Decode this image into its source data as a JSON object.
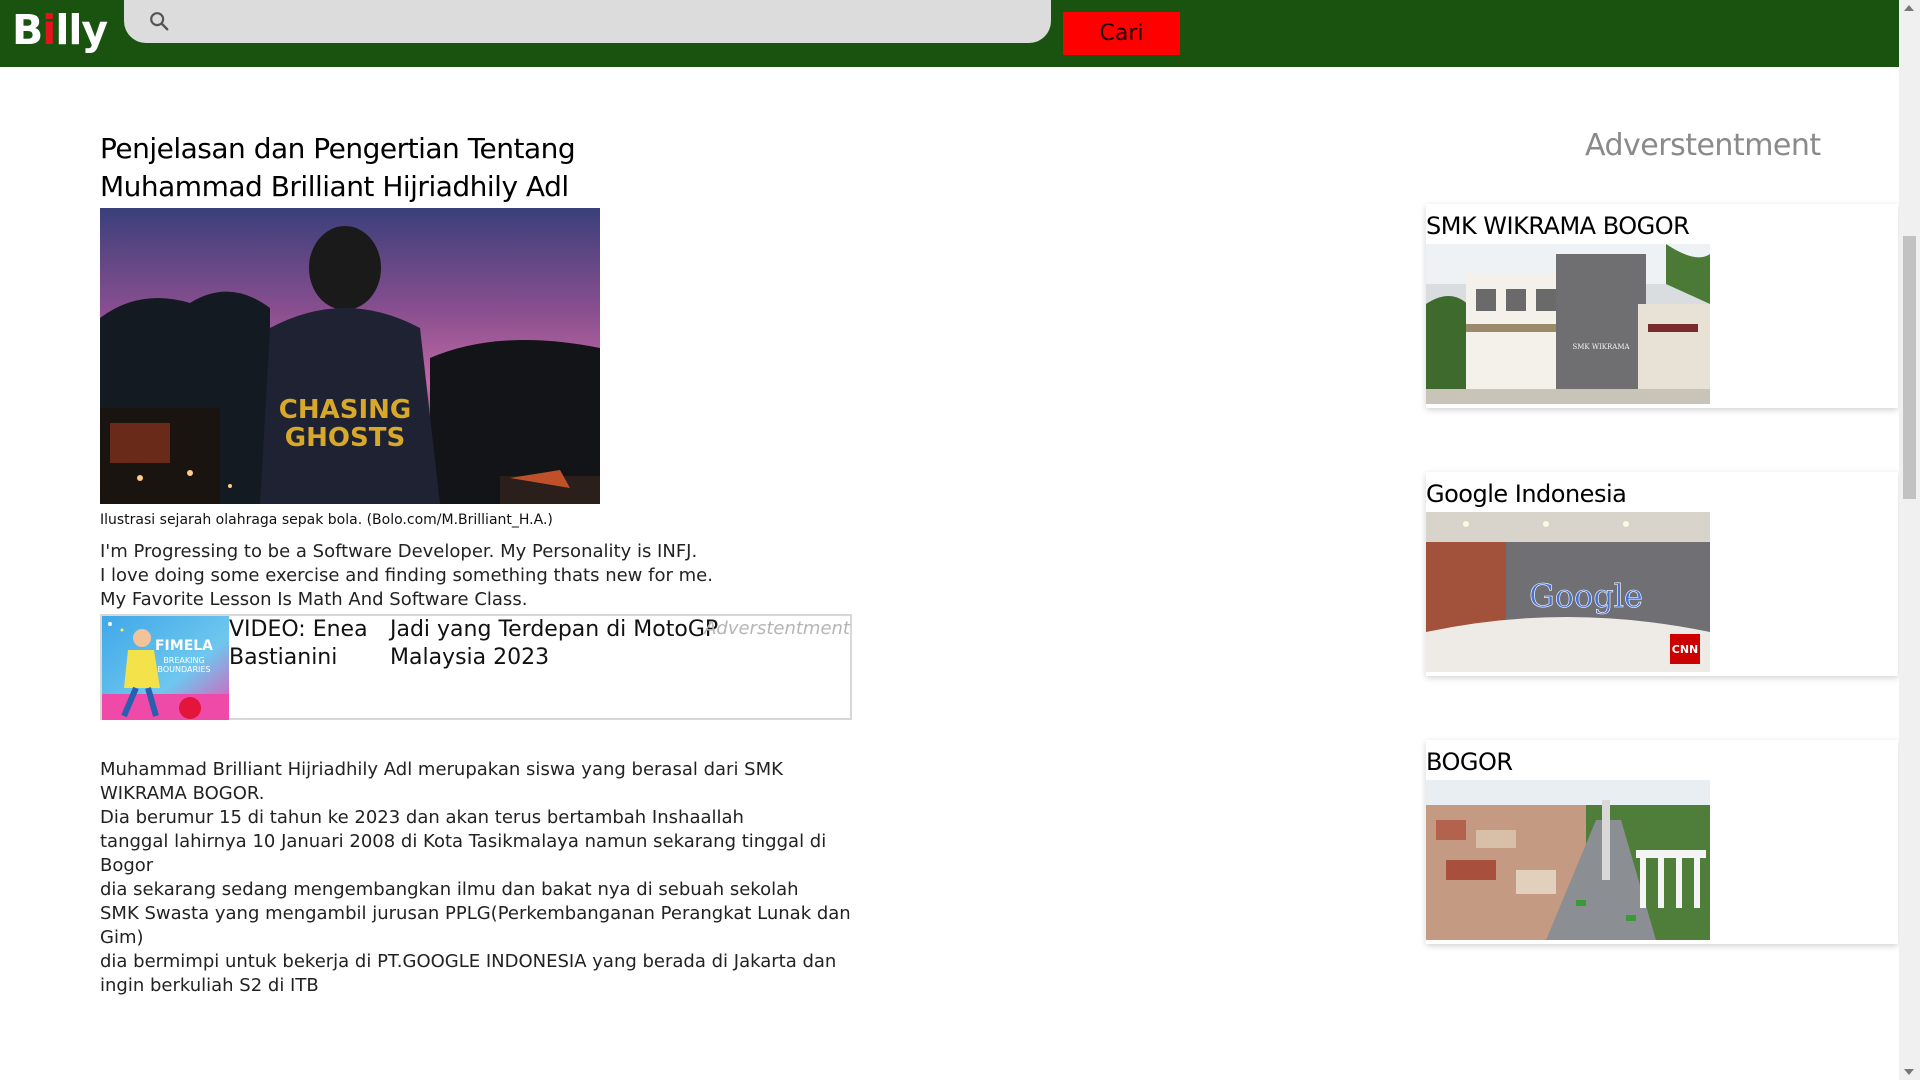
{
  "header": {
    "logo_b": "B",
    "logo_i": "i",
    "logo_rest": "lly",
    "search_placeholder": "",
    "search_button": "Cari",
    "colors": {
      "bar": "#1a5310",
      "button": "#ff0000",
      "accent": "#e5141b"
    }
  },
  "article": {
    "title_line1": "Penjelasan dan Pengertian Tentang",
    "title_line2": "Muhammad Brilliant Hijriadhily Adl",
    "hero_alt_words": "CHASING GHOSTS",
    "caption": "Ilustrasi sejarah olahraga sepak bola. (Bolo.com/M.Brilliant_H.A.)",
    "intro": [
      "I'm Progressing to be a Software Developer. My Personality is INFJ.",
      "I love doing some exercise and finding something thats new for me.",
      "My Favorite Lesson Is Math And Software Class."
    ],
    "ad": {
      "thumb_brand": "FIMELA",
      "thumb_tagline_1": "BREAKING",
      "thumb_tagline_2": "BOUNDARIES",
      "text1": "VIDEO: Enea Bastianini",
      "text2": "Jadi yang Terdepan di MotoGP Malaysia 2023",
      "label": "Adverstentment"
    },
    "body": [
      "Muhammad Brilliant Hijriadhily Adl merupakan siswa yang berasal dari SMK WIKRAMA BOGOR.",
      "Dia berumur 15 di tahun ke 2023 dan akan terus bertambah Inshaallah",
      "tanggal lahirnya 10 Januari 2008 di Kota Tasikmalaya namun sekarang tinggal di Bogor",
      "dia sekarang sedang mengembangkan ilmu dan bakat nya di sebuah sekolah",
      "SMK Swasta yang mengambil jurusan PPLG(Perkembanganan Perangkat Lunak dan Gim)",
      "dia bermimpi untuk bekerja di PT.GOOGLE INDONESIA yang berada di Jakarta dan ingin berkuliah S2 di ITB"
    ]
  },
  "sidebar": {
    "heading": "Adverstentment",
    "cards": [
      {
        "title": "SMK WIKRAMA BOGOR",
        "image_text": "SMK WIKRAMA"
      },
      {
        "title": "Google Indonesia",
        "image_text": "Google",
        "badge": "CNN"
      },
      {
        "title": "BOGOR"
      }
    ]
  }
}
